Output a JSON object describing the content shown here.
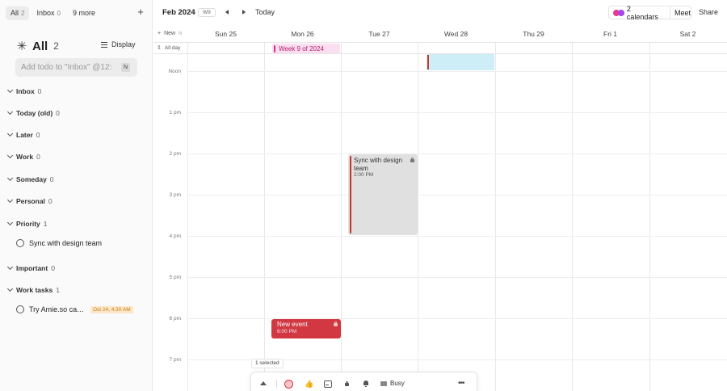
{
  "sidebar": {
    "tabs": [
      {
        "label": "All",
        "count": "2"
      },
      {
        "label": "Inbox",
        "count": "0"
      },
      {
        "label": "9 more",
        "count": ""
      }
    ],
    "add_icon": "plus-icon",
    "title": "All",
    "title_count": "2",
    "display_label": "Display",
    "add_todo_placeholder": "Add todo to \"Inbox\" @12:00",
    "add_todo_shortcut": "N",
    "groups": [
      {
        "name": "Inbox",
        "count": "0"
      },
      {
        "name": "Today (old)",
        "count": "0"
      },
      {
        "name": "Later",
        "count": "0"
      },
      {
        "name": "Work",
        "count": "0"
      },
      {
        "name": "Someday",
        "count": "0"
      },
      {
        "name": "Personal",
        "count": "0"
      },
      {
        "name": "Priority",
        "count": "1"
      },
      {
        "name": "Important",
        "count": "0"
      },
      {
        "name": "Work tasks",
        "count": "1"
      }
    ],
    "todos": [
      {
        "text": "Sync with design team",
        "badge": ""
      },
      {
        "text": "Try Amie.so ca…",
        "badge": "Oct 24, 4:30 AM"
      }
    ]
  },
  "header": {
    "month": "Feb 2024",
    "week_badge": "W9",
    "today_label": "Today",
    "calendars_label": "2 calendars",
    "meet_label": "Meet",
    "share_label": "Share",
    "new_label": "New",
    "new_shortcut": "N"
  },
  "days": [
    {
      "label": "Sun 25"
    },
    {
      "label": "Mon 26"
    },
    {
      "label": "Tue 27"
    },
    {
      "label": "Wed 28"
    },
    {
      "label": "Thu 29"
    },
    {
      "label": "Fri  1"
    },
    {
      "label": "Sat  2"
    }
  ],
  "allday_label": "All day",
  "hours": [
    "Noon",
    "1 pm",
    "2 pm",
    "3 pm",
    "4 pm",
    "5 pm",
    "6 pm",
    "7 pm"
  ],
  "events": {
    "allday": {
      "title": "Week 9 of 2024"
    },
    "sync": {
      "title": "Sync with design team",
      "time": "2:00 PM"
    },
    "new_event": {
      "title": "New event",
      "time": "6:00 PM"
    }
  },
  "toolbar": {
    "selected_label": "1 selected",
    "thumb_glyph": "👍",
    "busy_label": "Busy",
    "more_glyph": "•••"
  },
  "colors": {
    "calendar_dot_1": "#e8398e",
    "calendar_dot_2": "#a347e8",
    "event_red": "#d13842",
    "allday_pink": "#fbdff0",
    "cyan_event": "#cdeef7"
  }
}
